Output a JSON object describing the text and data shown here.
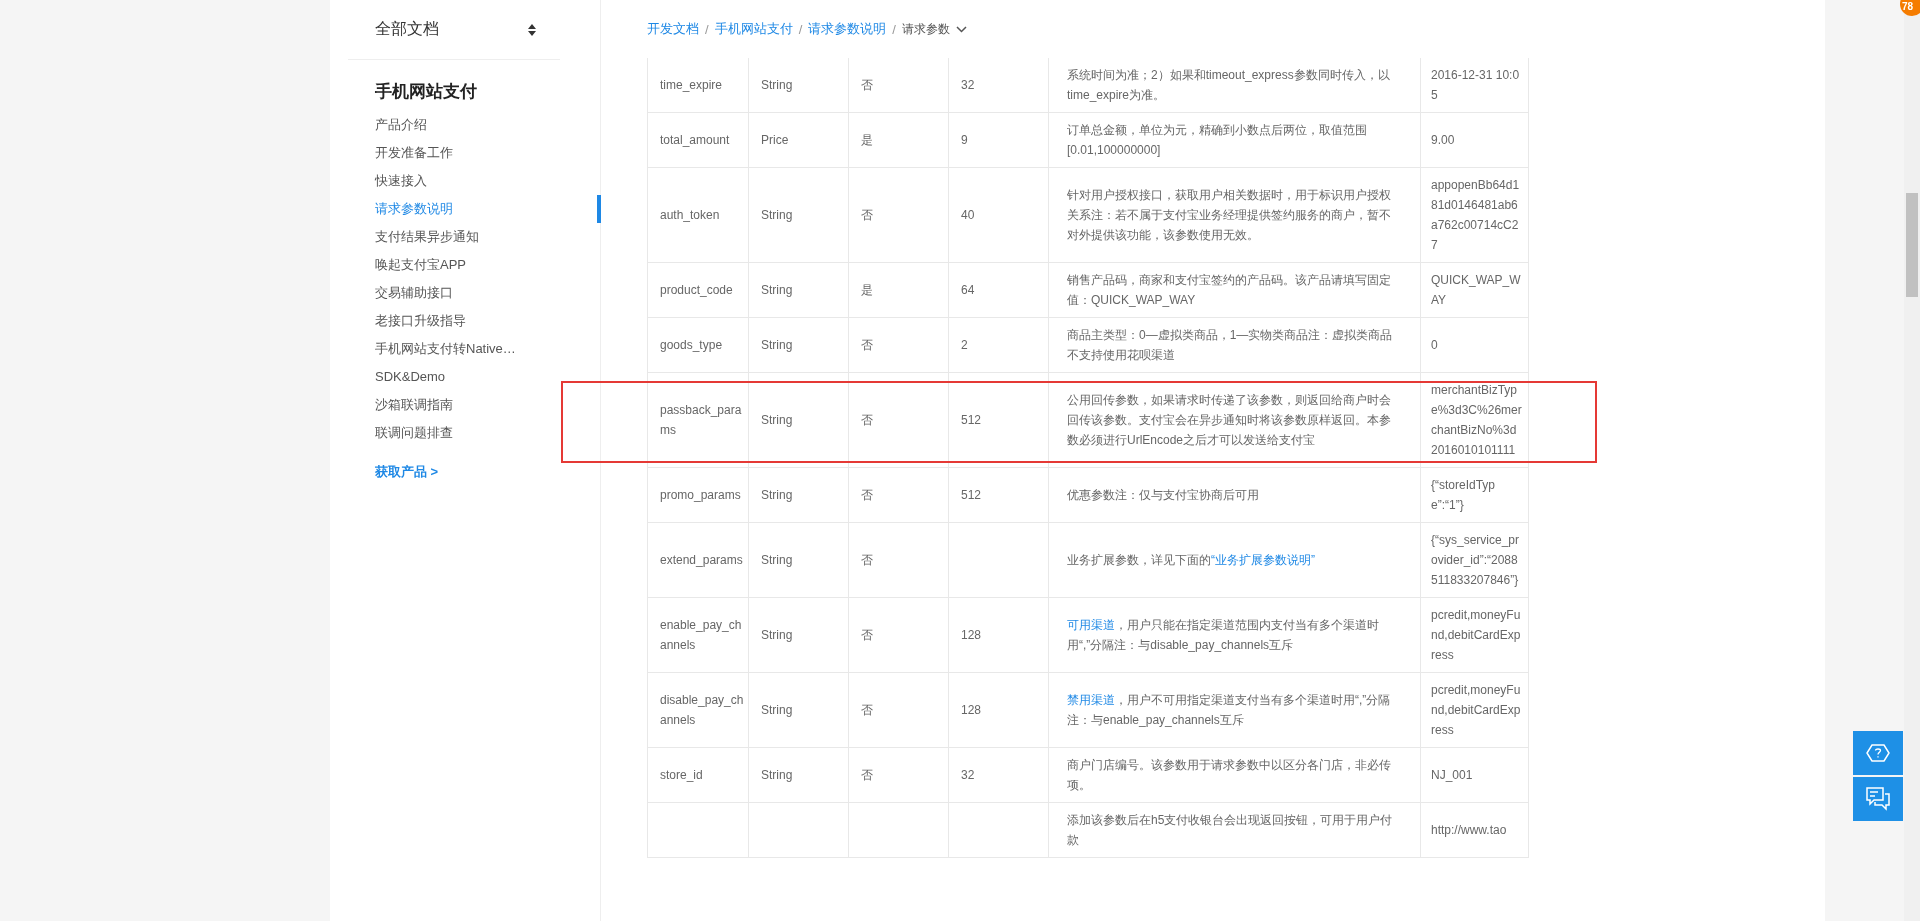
{
  "sidebar": {
    "title": "全部文档",
    "section": "手机网站支付",
    "items": [
      {
        "label": "产品介绍",
        "selected": false
      },
      {
        "label": "开发准备工作",
        "selected": false
      },
      {
        "label": "快速接入",
        "selected": false
      },
      {
        "label": "请求参数说明",
        "selected": true
      },
      {
        "label": "支付结果异步通知",
        "selected": false
      },
      {
        "label": "唤起支付宝APP",
        "selected": false
      },
      {
        "label": "交易辅助接口",
        "selected": false
      },
      {
        "label": "老接口升级指导",
        "selected": false
      },
      {
        "label": "手机网站支付转Native…",
        "selected": false
      },
      {
        "label": "SDK&Demo",
        "selected": false
      },
      {
        "label": "沙箱联调指南",
        "selected": false
      },
      {
        "label": "联调问题排查",
        "selected": false
      }
    ],
    "cta": "获取产品 >"
  },
  "breadcrumb": {
    "separator": "/",
    "links": [
      "开发文档",
      "手机网站支付",
      "请求参数说明"
    ],
    "current": "请求参数"
  },
  "table": {
    "rows": [
      {
        "name": "time_expire",
        "type": "String",
        "required": "否",
        "length": "32",
        "description": [
          {
            "text": "系统时间为准；2）如果和timeout_express参数同时传入，以time_expire为准。",
            "link": false
          }
        ],
        "example": "2016-12-31 10:05",
        "highlighted": false
      },
      {
        "name": "total_amount",
        "type": "Price",
        "required": "是",
        "length": "9",
        "description": [
          {
            "text": "订单总金额，单位为元，精确到小数点后两位，取值范围[0.01,100000000]",
            "link": false
          }
        ],
        "example": "9.00",
        "highlighted": false
      },
      {
        "name": "auth_token",
        "type": "String",
        "required": "否",
        "length": "40",
        "description": [
          {
            "text": "针对用户授权接口，获取用户相关数据时，用于标识用户授权关系注：若不属于支付宝业务经理提供签约服务的商户，暂不对外提供该功能，该参数使用无效。",
            "link": false
          }
        ],
        "example": "appopenBb64d181d0146481ab6a762c00714cC27",
        "highlighted": false
      },
      {
        "name": "product_code",
        "type": "String",
        "required": "是",
        "length": "64",
        "description": [
          {
            "text": "销售产品码，商家和支付宝签约的产品码。该产品请填写固定值：QUICK_WAP_WAY",
            "link": false
          }
        ],
        "example": "QUICK_WAP_WAY",
        "highlighted": false
      },
      {
        "name": "goods_type",
        "type": "String",
        "required": "否",
        "length": "2",
        "description": [
          {
            "text": "商品主类型：0—虚拟类商品，1—实物类商品注：虚拟类商品不支持使用花呗渠道",
            "link": false
          }
        ],
        "example": "0",
        "highlighted": false
      },
      {
        "name": "passback_params",
        "type": "String",
        "required": "否",
        "length": "512",
        "description": [
          {
            "text": "公用回传参数，如果请求时传递了该参数，则返回给商户时会回传该参数。支付宝会在异步通知时将该参数原样返回。本参数必须进行UrlEncode之后才可以发送给支付宝",
            "link": false
          }
        ],
        "example": "merchantBizType%3d3C%26merchantBizNo%3d2016010101111",
        "highlighted": true
      },
      {
        "name": "promo_params",
        "type": "String",
        "required": "否",
        "length": "512",
        "description": [
          {
            "text": "优惠参数注：仅与支付宝协商后可用",
            "link": false
          }
        ],
        "example": "{“storeIdType”:“1”}",
        "highlighted": false
      },
      {
        "name": "extend_params",
        "type": "String",
        "required": "否",
        "length": "",
        "description": [
          {
            "text": "业务扩展参数，详见下面的",
            "link": false
          },
          {
            "text": "“业务扩展参数说明”",
            "link": true
          }
        ],
        "example": "{“sys_service_provider_id”:“2088511833207846”}",
        "highlighted": false
      },
      {
        "name": "enable_pay_channels",
        "type": "String",
        "required": "否",
        "length": "128",
        "description": [
          {
            "text": "可用渠道",
            "link": true
          },
          {
            "text": "，用户只能在指定渠道范围内支付当有多个渠道时用“,”分隔注：与disable_pay_channels互斥",
            "link": false
          }
        ],
        "example": "pcredit,moneyFund,debitCardExpress",
        "highlighted": false
      },
      {
        "name": "disable_pay_channels",
        "type": "String",
        "required": "否",
        "length": "128",
        "description": [
          {
            "text": "禁用渠道",
            "link": true
          },
          {
            "text": "，用户不可用指定渠道支付当有多个渠道时用“,”分隔注：与enable_pay_channels互斥",
            "link": false
          }
        ],
        "example": "pcredit,moneyFund,debitCardExpress",
        "highlighted": false
      },
      {
        "name": "store_id",
        "type": "String",
        "required": "否",
        "length": "32",
        "description": [
          {
            "text": "商户门店编号。该参数用于请求参数中以区分各门店，非必传项。",
            "link": false
          }
        ],
        "example": "NJ_001",
        "highlighted": false
      },
      {
        "name": "",
        "type": "",
        "required": "",
        "length": "",
        "description": [
          {
            "text": "添加该参数后在h5支付收银台会出现返回按钮，可用于用户付款",
            "link": false
          }
        ],
        "example": "http://www.tao",
        "highlighted": false
      }
    ]
  },
  "badge": "78"
}
